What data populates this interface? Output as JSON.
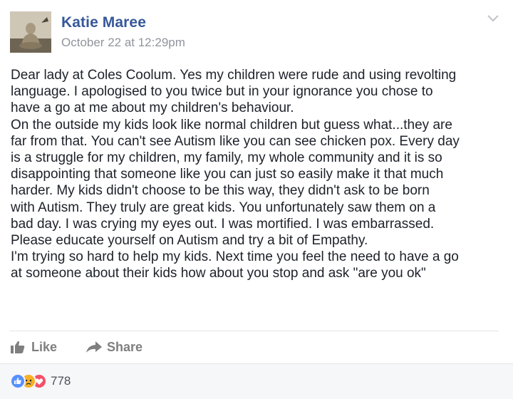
{
  "post": {
    "author": "Katie Maree",
    "timestamp": "October 22 at 12:29pm",
    "text": "Dear lady at Coles Coolum. Yes my children were rude and using revolting\nlanguage. I apologised to you twice but in your ignorance you chose to\nhave a go at me about my children's behaviour.\nOn the outside my kids look like normal children but guess what...they are\nfar from that. You can't see Autism like you can see chicken pox. Every day\nis a struggle for my children, my family, my whole community and it is so\ndisappointing that someone like you can just so easily make it that much\nharder. My kids didn't choose to be this way, they didn't ask to be born\nwith Autism. They truly are great kids. You unfortunately saw them on a\nbad day. I was crying my eyes out. I was mortified. I was embarrassed.\nPlease educate yourself on Autism and try a bit of Empathy.\nI'm trying so hard to help my kids. Next time you feel the need to have a go\nat someone about their kids how about you stop and ask \"are you ok\""
  },
  "actions": {
    "like_label": "Like",
    "share_label": "Share"
  },
  "reactions": {
    "types": [
      "like-icon",
      "sad-icon",
      "love-icon"
    ],
    "count": "778"
  },
  "colors": {
    "author": "#365899",
    "timestamp": "#90949c",
    "action": "#7f7f7f",
    "like": "#5890ff",
    "sad": "#f7b125",
    "love": "#f25268"
  }
}
